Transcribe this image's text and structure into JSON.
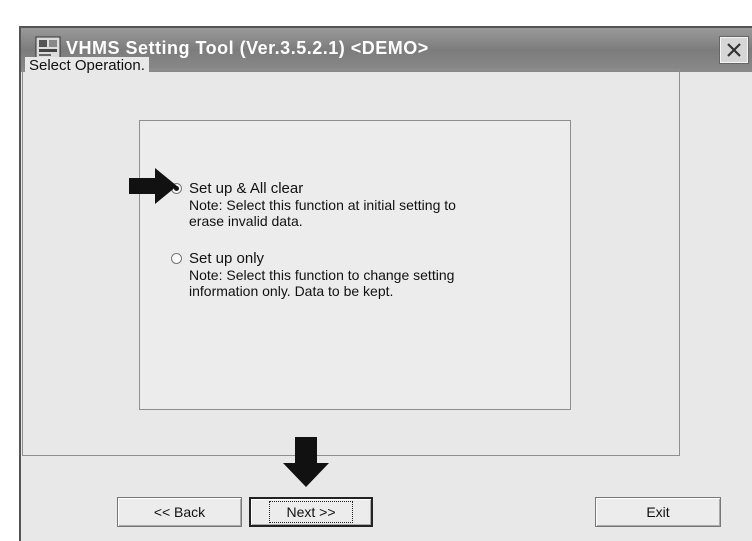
{
  "window": {
    "title": "VHMS Setting Tool  (Ver.3.5.2.1) <DEMO>",
    "icon": "vhms-app-icon",
    "close_icon": "close-icon"
  },
  "group": {
    "label": "Select Operation."
  },
  "options": [
    {
      "label": "Set up & All clear",
      "note_line1": "Note: Select this function at initial setting to",
      "note_line2": "erase invalid data.",
      "selected": true
    },
    {
      "label": "Set up only",
      "note_line1": "Note: Select this function to change setting",
      "note_line2": "information only. Data to be kept.",
      "selected": false
    }
  ],
  "buttons": {
    "back_label": "<< Back",
    "next_label": "Next >>",
    "exit_label": "Exit"
  },
  "colors": {
    "titlebar": "#8a8a8a",
    "window_bg": "#e8e8e8",
    "arrow": "#111111"
  }
}
